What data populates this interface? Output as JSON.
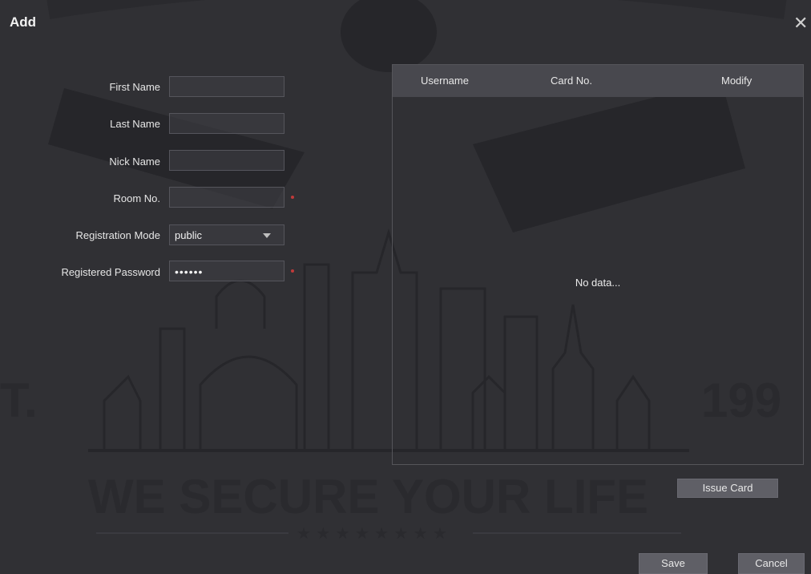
{
  "dialog": {
    "title": "Add",
    "close_icon": "close-icon"
  },
  "form": {
    "first_name": {
      "label": "First Name",
      "value": ""
    },
    "last_name": {
      "label": "Last Name",
      "value": ""
    },
    "nick_name": {
      "label": "Nick Name",
      "value": ""
    },
    "room_no": {
      "label": "Room No.",
      "value": "",
      "required": true
    },
    "registration_mode": {
      "label": "Registration Mode",
      "value": "public"
    },
    "registered_password": {
      "label": "Registered Password",
      "value": "••••••",
      "required": true
    }
  },
  "card_table": {
    "columns": [
      "Username",
      "Card No.",
      "Modify"
    ],
    "empty_text": "No data..."
  },
  "buttons": {
    "issue_card": "Issue Card",
    "save": "Save",
    "cancel": "Cancel"
  },
  "watermark": {
    "slogan": "WE SECURE YOUR LIFE",
    "est_left": "T.",
    "est_right": "199"
  },
  "colors": {
    "background": "#303034",
    "header": "#48484e",
    "button": "#5f5f66",
    "required": "#c03a3a"
  }
}
